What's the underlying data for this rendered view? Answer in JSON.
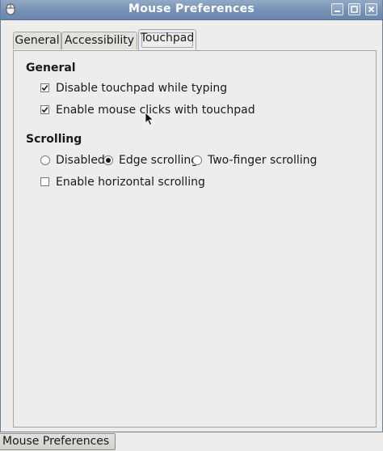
{
  "window": {
    "title": "Mouse Preferences",
    "icon": "mouse-icon",
    "controls": [
      "minimize-icon",
      "maximize-icon",
      "close-icon"
    ]
  },
  "tabs": [
    {
      "label": "General",
      "active": false
    },
    {
      "label": "Accessibility",
      "active": false
    },
    {
      "label": "Touchpad",
      "active": true
    }
  ],
  "general_section": {
    "title": "General",
    "options": [
      {
        "label": "Disable touchpad while typing",
        "checked": true
      },
      {
        "label": "Enable mouse clicks with touchpad",
        "checked": true
      }
    ]
  },
  "scrolling_section": {
    "title": "Scrolling",
    "radios": [
      {
        "label": "Disabled",
        "selected": false
      },
      {
        "label": "Edge scrolling",
        "selected": true
      },
      {
        "label": "Two-finger scrolling",
        "selected": false
      }
    ],
    "horizontal": {
      "label": "Enable horizontal scrolling",
      "checked": false
    }
  },
  "taskbar": {
    "task_label": "Mouse Preferences"
  },
  "colors": {
    "titlebar": "#7591b5",
    "background": "#efedeb"
  }
}
